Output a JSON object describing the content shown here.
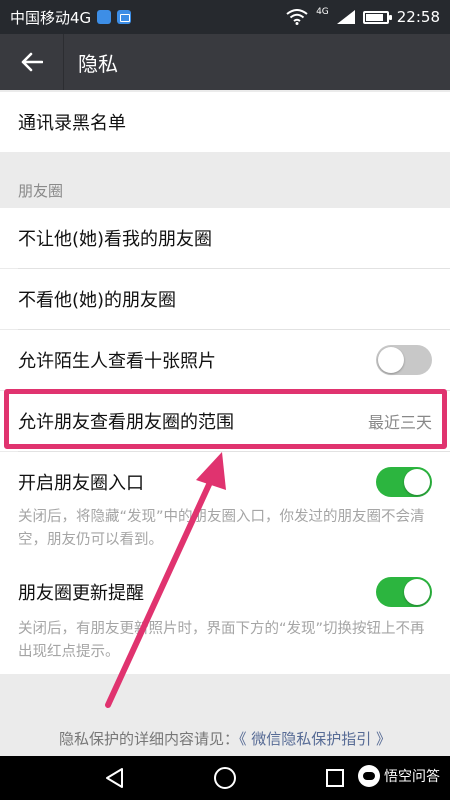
{
  "status_bar": {
    "carrier": "中国移动4G",
    "network_tag": "4G",
    "time": "22:58",
    "battery_level": 0.85,
    "icons": [
      "notification-icon",
      "image-icon",
      "wifi-icon",
      "signal-icon",
      "battery-icon"
    ]
  },
  "app_bar": {
    "title": "隐私",
    "back_icon": "arrow-left-icon"
  },
  "rows": {
    "blacklist": "通讯录黑名单",
    "section_moments": "朋友圈",
    "block_him": "不让他(她)看我的朋友圈",
    "hide_his": "不看他(她)的朋友圈",
    "strangers_label": "允许陌生人查看十张照片",
    "strangers_on": false,
    "range_label": "允许朋友查看朋友圈的范围",
    "range_value": "最近三天",
    "entry_label": "开启朋友圈入口",
    "entry_on": true,
    "entry_desc": "关闭后，将隐藏“发现”中的朋友圈入口，你发过的朋友圈不会清空，朋友仍可以看到。",
    "update_label": "朋友圈更新提醒",
    "update_on": true,
    "update_desc": "关闭后，有朋友更新照片时，界面下方的“发现”切换按钮上不再出现红点提示。"
  },
  "footer": {
    "prefix": "隐私保护的详细内容请见：",
    "link": "《 微信隐私保护指引 》"
  },
  "annotation": {
    "highlight_color": "#e0336f"
  },
  "colors": {
    "toggle_on": "#2cb53f",
    "toggle_off": "#c8c8c8",
    "app_bar": "#393a3f",
    "link": "#576b95"
  },
  "nav_bar": {
    "icons": [
      "back-triangle-icon",
      "home-circle-icon",
      "recents-square-icon"
    ]
  },
  "watermark": {
    "text": "悟空问答"
  }
}
